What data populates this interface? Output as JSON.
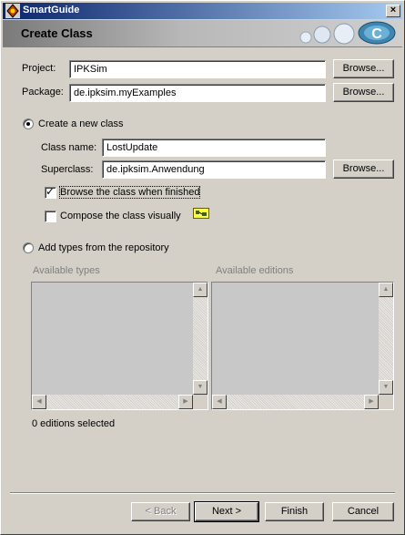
{
  "window": {
    "title": "SmartGuide",
    "close_glyph": "×"
  },
  "banner": {
    "heading": "Create Class",
    "logo_letter": "C"
  },
  "project": {
    "label": "Project:",
    "value": "IPKSim",
    "browse": "Browse..."
  },
  "package": {
    "label": "Package:",
    "value": "de.ipksim.myExamples",
    "browse": "Browse..."
  },
  "option_new_class": {
    "label": "Create a new class",
    "selected": true
  },
  "class_name": {
    "label": "Class name:",
    "value": "LostUpdate"
  },
  "superclass": {
    "label": "Superclass:",
    "value": "de.ipksim.Anwendung",
    "browse": "Browse..."
  },
  "browse_when_finished": {
    "label": "Browse the class when finished",
    "checked": true
  },
  "compose_visually": {
    "label": "Compose the class visually",
    "checked": false
  },
  "option_repository": {
    "label": "Add types from the repository",
    "selected": false
  },
  "available_types": {
    "label": "Available types"
  },
  "available_editions": {
    "label": "Available editions"
  },
  "status": {
    "text": "0 editions selected"
  },
  "buttons": {
    "back": "< Back",
    "next": "Next >",
    "finish": "Finish",
    "cancel": "Cancel"
  }
}
